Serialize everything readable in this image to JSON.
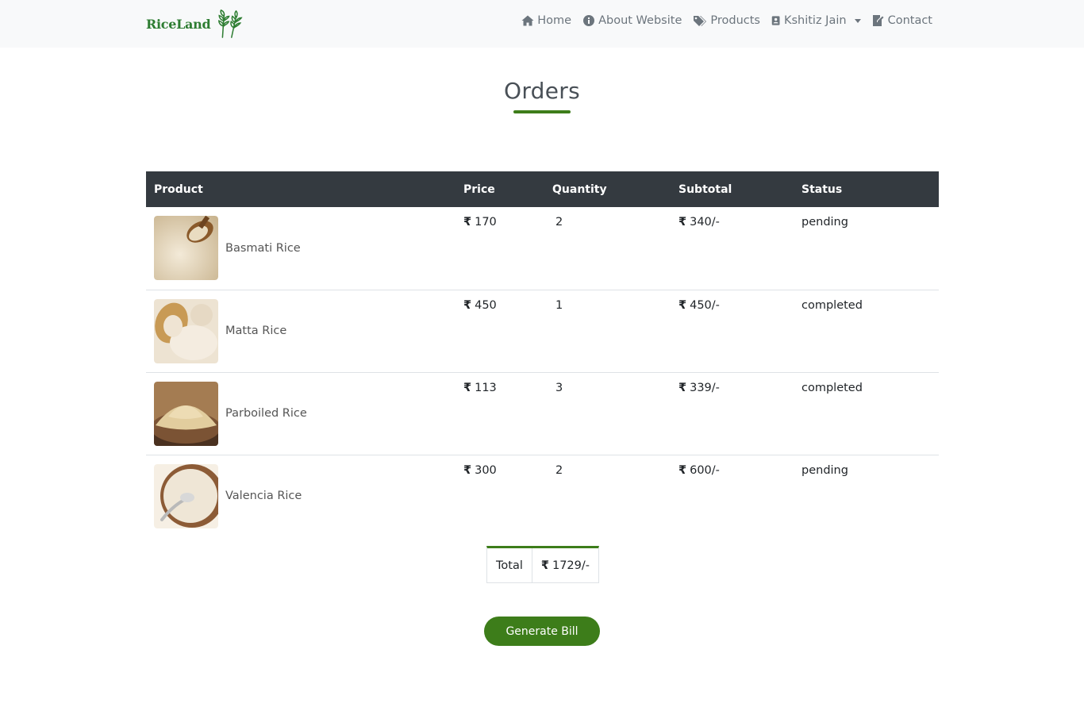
{
  "brand": {
    "name": "RiceLand"
  },
  "nav": {
    "home": "Home",
    "about": "About Website",
    "products": "Products",
    "user": "Kshitiz Jain",
    "contact": "Contact"
  },
  "page": {
    "title": "Orders"
  },
  "table": {
    "headers": [
      "Product",
      "Price",
      "Quantity",
      "Subtotal",
      "Status"
    ],
    "currency_symbol": "₹",
    "rows": [
      {
        "product": "Basmati Rice",
        "price": "170",
        "quantity": "2",
        "subtotal": "340/-",
        "status": "pending"
      },
      {
        "product": "Matta Rice",
        "price": "450",
        "quantity": "1",
        "subtotal": "450/-",
        "status": "completed"
      },
      {
        "product": "Parboiled Rice",
        "price": "113",
        "quantity": "3",
        "subtotal": "339/-",
        "status": "completed"
      },
      {
        "product": "Valencia Rice",
        "price": "300",
        "quantity": "2",
        "subtotal": "600/-",
        "status": "pending"
      }
    ]
  },
  "total": {
    "label": "Total",
    "value": "1729/-"
  },
  "actions": {
    "generate_bill": "Generate Bill"
  },
  "colors": {
    "accent": "#3d7d1a",
    "header_bg": "#343a40",
    "navbar_bg": "#f8f9fa",
    "brand": "#2e7d32"
  }
}
